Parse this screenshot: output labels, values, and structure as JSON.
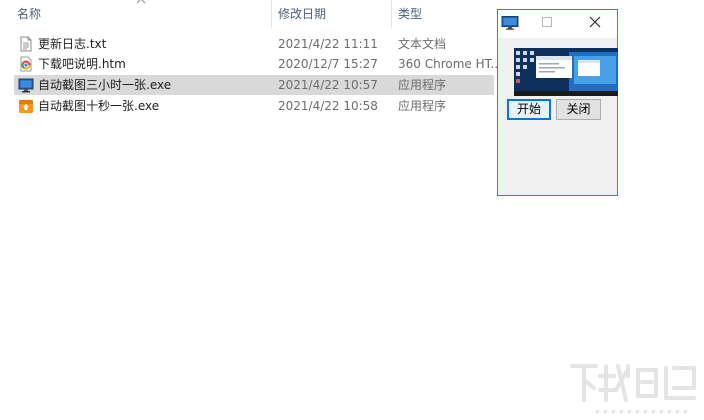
{
  "columns": {
    "name": "名称",
    "date": "修改日期",
    "type": "类型"
  },
  "files": [
    {
      "name": "更新日志.txt",
      "date": "2021/4/22 11:11",
      "type": "文本文档",
      "icon": "text-file-icon",
      "selected": false
    },
    {
      "name": "下载吧说明.htm",
      "date": "2020/12/7 15:27",
      "type": "360 Chrome HT...",
      "icon": "chrome-html-icon",
      "selected": false
    },
    {
      "name": "自动截图三小时一张.exe",
      "date": "2021/4/22 10:57",
      "type": "应用程序",
      "icon": "monitor-app-icon",
      "selected": true
    },
    {
      "name": "自动截图十秒一张.exe",
      "date": "2021/4/22 10:58",
      "type": "应用程序",
      "icon": "orange-app-icon",
      "selected": false
    }
  ],
  "app_window": {
    "start_label": "开始",
    "close_label": "关闭",
    "accent": "#0078d7"
  },
  "colors": {
    "header_text": "#4c607a",
    "selection": "#d9d9d9",
    "window_border": "#3c7fd4"
  }
}
